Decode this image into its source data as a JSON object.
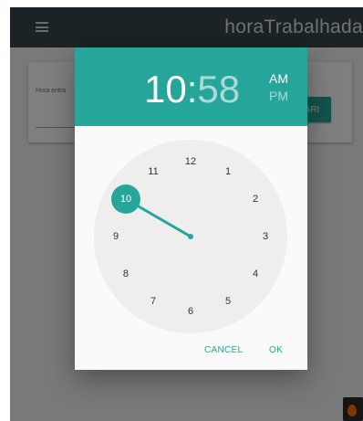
{
  "app": {
    "title": "horaTrabalhada",
    "menu_icon": "hamburger-menu-icon"
  },
  "card": {
    "field_label": "Hora entra",
    "button_label": "ARI"
  },
  "time_picker": {
    "hours": "10",
    "separator": ":",
    "minutes": "58",
    "am_label": "AM",
    "pm_label": "PM",
    "selected_period": "AM",
    "selected_hour": 10,
    "dial_numbers": [
      "12",
      "1",
      "2",
      "3",
      "4",
      "5",
      "6",
      "7",
      "8",
      "9",
      "10",
      "11"
    ],
    "cancel_label": "CANCEL",
    "ok_label": "OK",
    "accent_color": "#26a69a"
  }
}
